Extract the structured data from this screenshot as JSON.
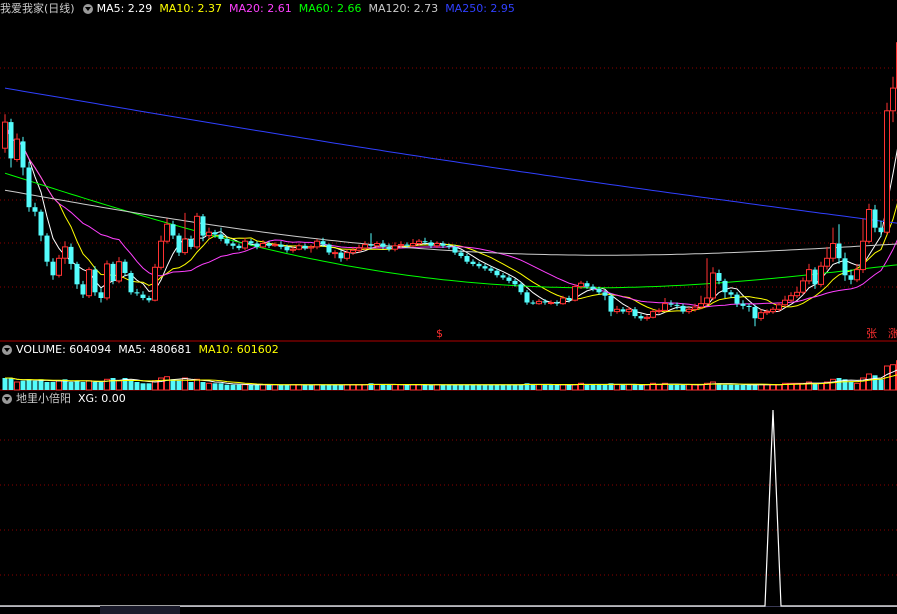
{
  "main_panel": {
    "title": "我爱我家(日线)",
    "ma_legend": [
      {
        "label": "MA5: 2.29",
        "color": "#ffffff"
      },
      {
        "label": "MA10: 2.37",
        "color": "#ffff00"
      },
      {
        "label": "MA20: 2.61",
        "color": "#ff40ff"
      },
      {
        "label": "MA60: 2.66",
        "color": "#00ff00"
      },
      {
        "label": "MA120: 2.73",
        "color": "#cccccc"
      },
      {
        "label": "MA250: 2.95",
        "color": "#3040ff"
      }
    ],
    "markers": [
      {
        "text": "$",
        "name": "dollar-marker"
      },
      {
        "text": "张",
        "name": "zhang-marker"
      },
      {
        "text": "涨",
        "name": "zhang2-marker"
      }
    ]
  },
  "volume_panel": {
    "legend": [
      {
        "label": "VOLUME: 604094",
        "color": "#ffffff"
      },
      {
        "label": "MA5: 480681",
        "color": "#ffffff"
      },
      {
        "label": "MA10: 601602",
        "color": "#ffff00"
      }
    ]
  },
  "indicator_panel": {
    "title": "地里小倍阳",
    "legend": [
      {
        "label": "XG: 0.00",
        "color": "#ffffff"
      }
    ]
  },
  "colors": {
    "up": "#ff3232",
    "down": "#54fcfc",
    "grid": "#8b0000",
    "separator": "#b00000"
  },
  "chart_data": {
    "type": "candlestick",
    "series": [
      {
        "name": "MA5",
        "values": []
      },
      {
        "name": "MA10",
        "values": []
      },
      {
        "name": "MA20",
        "values": []
      },
      {
        "name": "MA60",
        "values": []
      },
      {
        "name": "MA120",
        "values": []
      },
      {
        "name": "MA250",
        "values": []
      }
    ],
    "candles": [
      [
        3.22,
        3.45,
        3.52,
        3.18
      ],
      [
        3.45,
        3.13,
        3.48,
        3.05
      ],
      [
        3.12,
        3.3,
        3.35,
        3.1
      ],
      [
        3.28,
        3.05,
        3.32,
        2.98
      ],
      [
        3.05,
        2.7,
        3.1,
        2.66
      ],
      [
        2.7,
        2.66,
        2.74,
        2.62
      ],
      [
        2.66,
        2.45,
        2.68,
        2.4
      ],
      [
        2.45,
        2.22,
        2.47,
        2.18
      ],
      [
        2.22,
        2.1,
        2.25,
        2.06
      ],
      [
        2.1,
        2.25,
        2.28,
        2.08
      ],
      [
        2.25,
        2.35,
        2.4,
        2.2
      ],
      [
        2.35,
        2.2,
        2.38,
        2.15
      ],
      [
        2.2,
        2.02,
        2.22,
        1.98
      ],
      [
        2.02,
        1.93,
        2.05,
        1.9
      ],
      [
        1.92,
        2.15,
        2.17,
        1.9
      ],
      [
        2.15,
        1.95,
        2.18,
        1.92
      ],
      [
        1.95,
        1.9,
        1.99,
        1.86
      ],
      [
        1.9,
        2.2,
        2.23,
        1.88
      ],
      [
        2.2,
        2.05,
        2.22,
        2.02
      ],
      [
        2.05,
        2.22,
        2.26,
        2.03
      ],
      [
        2.22,
        2.12,
        2.24,
        2.09
      ],
      [
        2.12,
        1.95,
        2.14,
        1.93
      ],
      [
        1.95,
        1.94,
        1.98,
        1.92
      ],
      [
        1.93,
        1.9,
        1.96,
        1.88
      ],
      [
        1.9,
        1.88,
        1.92,
        1.86
      ],
      [
        1.88,
        2.17,
        2.2,
        1.87
      ],
      [
        2.17,
        2.4,
        2.45,
        2.15
      ],
      [
        2.4,
        2.55,
        2.6,
        2.38
      ],
      [
        2.55,
        2.45,
        2.58,
        2.42
      ],
      [
        2.45,
        2.3,
        2.47,
        2.27
      ],
      [
        2.3,
        2.42,
        2.65,
        2.28
      ],
      [
        2.42,
        2.35,
        2.45,
        2.33
      ],
      [
        2.35,
        2.62,
        2.65,
        2.33
      ],
      [
        2.62,
        2.45,
        2.64,
        2.4
      ],
      [
        2.45,
        2.48,
        2.52,
        2.42
      ],
      [
        2.48,
        2.46,
        2.5,
        2.43
      ],
      [
        2.46,
        2.42,
        2.52,
        2.4
      ],
      [
        2.42,
        2.38,
        2.44,
        2.36
      ],
      [
        2.38,
        2.36,
        2.4,
        2.33
      ],
      [
        2.36,
        2.34,
        2.38,
        2.32
      ],
      [
        2.34,
        2.4,
        2.43,
        2.32
      ],
      [
        2.4,
        2.38,
        2.42,
        2.36
      ],
      [
        2.38,
        2.35,
        2.4,
        2.33
      ],
      [
        2.35,
        2.38,
        2.41,
        2.34
      ],
      [
        2.38,
        2.36,
        2.4,
        2.34
      ],
      [
        2.36,
        2.37,
        2.39,
        2.35
      ],
      [
        2.37,
        2.35,
        2.4,
        2.33
      ],
      [
        2.35,
        2.32,
        2.37,
        2.3
      ],
      [
        2.32,
        2.33,
        2.35,
        2.3
      ],
      [
        2.33,
        2.36,
        2.38,
        2.32
      ],
      [
        2.36,
        2.34,
        2.38,
        2.32
      ],
      [
        2.34,
        2.35,
        2.37,
        2.3
      ],
      [
        2.35,
        2.4,
        2.42,
        2.33
      ],
      [
        2.4,
        2.37,
        2.43,
        2.35
      ],
      [
        2.37,
        2.3,
        2.38,
        2.28
      ],
      [
        2.3,
        2.3,
        2.32,
        2.25
      ],
      [
        2.3,
        2.25,
        2.32,
        2.22
      ],
      [
        2.25,
        2.3,
        2.33,
        2.23
      ],
      [
        2.3,
        2.32,
        2.35,
        2.28
      ],
      [
        2.32,
        2.34,
        2.37,
        2.3
      ],
      [
        2.34,
        2.37,
        2.4,
        2.32
      ],
      [
        2.37,
        2.36,
        2.47,
        2.33
      ],
      [
        2.36,
        2.38,
        2.4,
        2.34
      ],
      [
        2.38,
        2.35,
        2.41,
        2.33
      ],
      [
        2.35,
        2.33,
        2.38,
        2.31
      ],
      [
        2.33,
        2.36,
        2.39,
        2.31
      ],
      [
        2.36,
        2.37,
        2.4,
        2.34
      ],
      [
        2.37,
        2.36,
        2.39,
        2.34
      ],
      [
        2.36,
        2.38,
        2.42,
        2.35
      ],
      [
        2.38,
        2.4,
        2.42,
        2.36
      ],
      [
        2.4,
        2.39,
        2.43,
        2.37
      ],
      [
        2.39,
        2.36,
        2.41,
        2.34
      ],
      [
        2.36,
        2.38,
        2.4,
        2.34
      ],
      [
        2.38,
        2.36,
        2.4,
        2.34
      ],
      [
        2.36,
        2.35,
        2.38,
        2.33
      ],
      [
        2.35,
        2.3,
        2.37,
        2.28
      ],
      [
        2.3,
        2.27,
        2.32,
        2.25
      ],
      [
        2.27,
        2.22,
        2.29,
        2.2
      ],
      [
        2.22,
        2.2,
        2.24,
        2.18
      ],
      [
        2.2,
        2.18,
        2.22,
        2.16
      ],
      [
        2.18,
        2.16,
        2.2,
        2.14
      ],
      [
        2.16,
        2.14,
        2.18,
        2.12
      ],
      [
        2.14,
        2.1,
        2.16,
        2.08
      ],
      [
        2.1,
        2.08,
        2.12,
        2.06
      ],
      [
        2.08,
        2.05,
        2.1,
        2.03
      ],
      [
        2.05,
        2.02,
        2.07,
        2.0
      ],
      [
        2.02,
        1.95,
        2.04,
        1.93
      ],
      [
        1.95,
        1.86,
        1.97,
        1.84
      ],
      [
        1.86,
        1.85,
        1.88,
        1.84
      ],
      [
        1.85,
        1.87,
        1.89,
        1.84
      ],
      [
        1.87,
        1.86,
        1.89,
        1.84
      ],
      [
        1.86,
        1.86,
        1.88,
        1.84
      ],
      [
        1.86,
        1.85,
        1.88,
        1.83
      ],
      [
        1.85,
        1.9,
        1.92,
        1.84
      ],
      [
        1.9,
        1.88,
        1.92,
        1.86
      ],
      [
        1.88,
        2.0,
        2.02,
        1.87
      ],
      [
        2.0,
        2.03,
        2.05,
        1.98
      ],
      [
        2.03,
        2.0,
        2.05,
        1.98
      ],
      [
        2.0,
        1.98,
        2.02,
        1.96
      ],
      [
        1.98,
        1.95,
        2.0,
        1.93
      ],
      [
        1.95,
        1.92,
        1.97,
        1.88
      ],
      [
        1.92,
        1.78,
        1.94,
        1.74
      ],
      [
        1.78,
        1.8,
        1.83,
        1.76
      ],
      [
        1.8,
        1.78,
        1.82,
        1.76
      ],
      [
        1.78,
        1.8,
        1.82,
        1.75
      ],
      [
        1.8,
        1.74,
        1.82,
        1.72
      ],
      [
        1.74,
        1.72,
        1.76,
        1.7
      ],
      [
        1.72,
        1.73,
        1.75,
        1.7
      ],
      [
        1.73,
        1.78,
        1.8,
        1.72
      ],
      [
        1.78,
        1.79,
        1.81,
        1.76
      ],
      [
        1.79,
        1.85,
        1.9,
        1.78
      ],
      [
        1.85,
        1.84,
        1.88,
        1.82
      ],
      [
        1.84,
        1.83,
        1.86,
        1.8
      ],
      [
        1.83,
        1.78,
        1.85,
        1.76
      ],
      [
        1.78,
        1.8,
        1.82,
        1.76
      ],
      [
        1.8,
        1.82,
        1.85,
        1.78
      ],
      [
        1.82,
        1.85,
        1.92,
        1.8
      ],
      [
        1.85,
        1.9,
        2.25,
        1.83
      ],
      [
        1.9,
        2.12,
        2.17,
        1.88
      ],
      [
        2.12,
        2.05,
        2.15,
        2.02
      ],
      [
        2.05,
        1.95,
        2.07,
        1.9
      ],
      [
        1.95,
        1.93,
        1.97,
        1.9
      ],
      [
        1.93,
        1.85,
        1.95,
        1.82
      ],
      [
        1.85,
        1.83,
        1.88,
        1.8
      ],
      [
        1.83,
        1.82,
        1.85,
        1.78
      ],
      [
        1.82,
        1.72,
        1.84,
        1.65
      ],
      [
        1.72,
        1.77,
        1.8,
        1.7
      ],
      [
        1.77,
        1.78,
        1.8,
        1.75
      ],
      [
        1.78,
        1.8,
        1.82,
        1.76
      ],
      [
        1.8,
        1.84,
        1.86,
        1.78
      ],
      [
        1.84,
        1.88,
        1.92,
        1.82
      ],
      [
        1.88,
        1.92,
        1.95,
        1.86
      ],
      [
        1.92,
        1.95,
        2.0,
        1.9
      ],
      [
        1.95,
        2.05,
        2.08,
        1.93
      ],
      [
        2.05,
        2.15,
        2.2,
        2.02
      ],
      [
        2.15,
        2.02,
        2.17,
        1.98
      ],
      [
        2.02,
        2.18,
        2.22,
        2.0
      ],
      [
        2.18,
        2.25,
        2.35,
        2.15
      ],
      [
        2.25,
        2.38,
        2.52,
        2.22
      ],
      [
        2.38,
        2.25,
        2.55,
        2.2
      ],
      [
        2.25,
        2.1,
        2.3,
        2.05
      ],
      [
        2.1,
        2.06,
        2.15,
        2.02
      ],
      [
        2.06,
        2.15,
        2.2,
        2.04
      ],
      [
        2.15,
        2.4,
        2.6,
        2.12
      ],
      [
        2.4,
        2.68,
        2.73,
        2.38
      ],
      [
        2.68,
        2.52,
        2.72,
        2.48
      ],
      [
        2.52,
        2.48,
        2.58,
        2.44
      ],
      [
        2.48,
        3.55,
        3.62,
        2.46
      ],
      [
        3.55,
        3.75,
        3.85,
        3.45
      ],
      [
        3.75,
        4.15,
        4.25,
        3.7
      ],
      [
        4.15,
        3.82,
        4.2,
        3.75
      ]
    ],
    "ylim": [
      1.6,
      4.35
    ],
    "volume": [
      [
        9,
        0
      ],
      [
        9,
        0
      ],
      [
        6,
        1
      ],
      [
        7,
        0
      ],
      [
        8,
        0
      ],
      [
        7,
        0
      ],
      [
        8,
        0
      ],
      [
        6,
        0
      ],
      [
        6,
        0
      ],
      [
        7,
        1
      ],
      [
        8,
        0
      ],
      [
        6,
        0
      ],
      [
        7,
        0
      ],
      [
        6,
        0
      ],
      [
        7,
        1
      ],
      [
        6,
        0
      ],
      [
        6,
        0
      ],
      [
        8,
        1
      ],
      [
        9,
        0
      ],
      [
        7,
        1
      ],
      [
        9,
        0
      ],
      [
        7,
        0
      ],
      [
        6,
        0
      ],
      [
        5,
        0
      ],
      [
        5,
        0
      ],
      [
        7,
        1
      ],
      [
        9,
        1
      ],
      [
        10,
        1
      ],
      [
        8,
        0
      ],
      [
        7,
        0
      ],
      [
        9,
        1
      ],
      [
        6,
        0
      ],
      [
        8,
        1
      ],
      [
        6,
        0
      ],
      [
        5,
        1
      ],
      [
        5,
        0
      ],
      [
        5,
        0
      ],
      [
        4,
        0
      ],
      [
        4,
        0
      ],
      [
        4,
        0
      ],
      [
        4,
        1
      ],
      [
        4,
        0
      ],
      [
        4,
        0
      ],
      [
        4,
        1
      ],
      [
        4,
        0
      ],
      [
        4,
        1
      ],
      [
        4,
        0
      ],
      [
        4,
        0
      ],
      [
        4,
        1
      ],
      [
        4,
        1
      ],
      [
        4,
        0
      ],
      [
        4,
        0
      ],
      [
        4,
        1
      ],
      [
        4,
        0
      ],
      [
        4,
        0
      ],
      [
        4,
        0
      ],
      [
        4,
        0
      ],
      [
        4,
        1
      ],
      [
        4,
        1
      ],
      [
        4,
        1
      ],
      [
        4,
        1
      ],
      [
        5,
        0
      ],
      [
        4,
        1
      ],
      [
        4,
        0
      ],
      [
        4,
        0
      ],
      [
        4,
        1
      ],
      [
        4,
        1
      ],
      [
        4,
        0
      ],
      [
        4,
        1
      ],
      [
        4,
        1
      ],
      [
        4,
        0
      ],
      [
        4,
        0
      ],
      [
        4,
        1
      ],
      [
        4,
        0
      ],
      [
        4,
        0
      ],
      [
        4,
        0
      ],
      [
        4,
        0
      ],
      [
        4,
        0
      ],
      [
        4,
        0
      ],
      [
        4,
        0
      ],
      [
        4,
        0
      ],
      [
        4,
        0
      ],
      [
        4,
        0
      ],
      [
        4,
        0
      ],
      [
        4,
        0
      ],
      [
        4,
        0
      ],
      [
        4,
        0
      ],
      [
        5,
        0
      ],
      [
        4,
        0
      ],
      [
        4,
        1
      ],
      [
        4,
        0
      ],
      [
        4,
        0
      ],
      [
        4,
        0
      ],
      [
        4,
        1
      ],
      [
        4,
        0
      ],
      [
        4,
        1
      ],
      [
        5,
        1
      ],
      [
        4,
        0
      ],
      [
        4,
        0
      ],
      [
        4,
        0
      ],
      [
        4,
        0
      ],
      [
        5,
        0
      ],
      [
        4,
        1
      ],
      [
        4,
        0
      ],
      [
        4,
        1
      ],
      [
        4,
        0
      ],
      [
        4,
        0
      ],
      [
        4,
        1
      ],
      [
        5,
        1
      ],
      [
        4,
        1
      ],
      [
        5,
        1
      ],
      [
        4,
        0
      ],
      [
        4,
        0
      ],
      [
        4,
        0
      ],
      [
        4,
        1
      ],
      [
        4,
        1
      ],
      [
        4,
        1
      ],
      [
        5,
        1
      ],
      [
        6,
        1
      ],
      [
        5,
        0
      ],
      [
        4,
        0
      ],
      [
        4,
        0
      ],
      [
        4,
        0
      ],
      [
        4,
        0
      ],
      [
        4,
        0
      ],
      [
        4,
        0
      ],
      [
        4,
        1
      ],
      [
        4,
        1
      ],
      [
        4,
        1
      ],
      [
        4,
        1
      ],
      [
        5,
        1
      ],
      [
        5,
        1
      ],
      [
        5,
        1
      ],
      [
        5,
        1
      ],
      [
        6,
        1
      ],
      [
        5,
        0
      ],
      [
        5,
        1
      ],
      [
        6,
        1
      ],
      [
        8,
        1
      ],
      [
        9,
        0
      ],
      [
        8,
        0
      ],
      [
        6,
        0
      ],
      [
        5,
        1
      ],
      [
        9,
        1
      ],
      [
        12,
        1
      ],
      [
        11,
        0
      ],
      [
        8,
        0
      ],
      [
        18,
        1
      ],
      [
        19,
        1
      ],
      [
        22,
        1
      ],
      [
        16,
        0
      ]
    ],
    "volume_ylim": [
      0,
      24
    ],
    "xg": {
      "spike_index": 128,
      "range": [
        0,
        1
      ]
    }
  }
}
